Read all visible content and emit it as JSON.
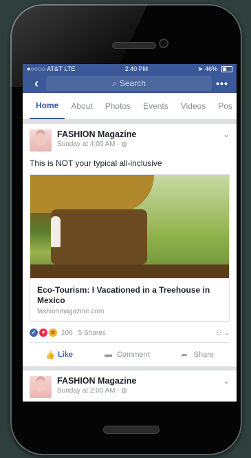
{
  "status": {
    "carrier": "●○○○○ AT&T",
    "network": "LTE",
    "time": "2:40 PM",
    "battery": "46%"
  },
  "nav": {
    "search_label": "Search",
    "more_label": "•••"
  },
  "tabs": [
    "Home",
    "About",
    "Photos",
    "Events",
    "Videos",
    "Pos"
  ],
  "post": {
    "page_name": "FASHION Magazine",
    "time": "Sunday at 4:00 AM · ◍",
    "text": "This is NOT your typical all-inclusive",
    "link": {
      "title": "Eco-Tourism: I Vacationed in a Treehouse in Mexico",
      "domain": "fashionmagazine.com"
    },
    "reactions_count": "106",
    "shares": "5 Shares",
    "actions": {
      "like": "Like",
      "comment": "Comment",
      "share": "Share"
    }
  },
  "post2": {
    "page_name": "FASHION Magazine",
    "time": "Sunday at 2:00 AM · ◍"
  },
  "colors": {
    "facebook_blue": "#3b5998"
  }
}
